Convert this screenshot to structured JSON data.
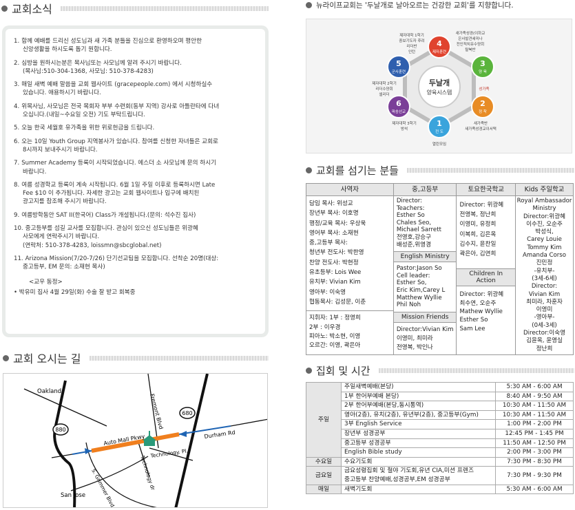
{
  "news": {
    "title": "교회소식",
    "items": [
      {
        "num": "1.",
        "lines": [
          "함께 예배를 드리신 성도님과 새 가족 분들을 진심으로 환영하오며 평안한",
          "신앙생활을 하시도록 돕기 원합니다."
        ]
      },
      {
        "num": "2.",
        "lines": [
          "심방을 원하시는분은 목사님또는 사모님께 알려 주시기 바랍니다.",
          "(목사님:510-304-1368, 사모님: 510-378-4283)"
        ]
      },
      {
        "num": "3.",
        "lines": [
          "매일 새벽 예배 말씀을 교회 웹사이트 (gracepeople.com) 에서 시청하실수",
          "있습니다. 애용하시기 바랍니다."
        ]
      },
      {
        "num": "4.",
        "lines": [
          "위목사님, 사모님은 전국 목회자 부부 수련회(동부 지역) 강사로 아틀란타에 다녀",
          "오십니다.(내일~수요일 오전) 기도 부탁드립니다."
        ]
      },
      {
        "num": "5.",
        "lines": [
          "오늘 한국 세월호 유가족을 위한 위로헌금을 드립니다."
        ]
      },
      {
        "num": "6.",
        "lines": [
          "오는 10일 Youth Group 지역봉사가 있습니다. 참여를 신청한 자녀들은 교회로",
          "8시까지 보내주시기 바랍니다."
        ]
      },
      {
        "num": "7.",
        "lines": [
          "Summer Academy 등록이 시작되었습니다. 에스더 소 사모님께 문의 하시기",
          "바랍니다."
        ]
      },
      {
        "num": "8.",
        "lines": [
          "여름 성경학교 등록이 계속 시작됩니다. 6월 1일 주일 이후로 등록하시면 Late",
          "Fee $10 이 추가됩니다. 자세한 광고는 교회 웹사이트나 입구에 배치된",
          "광고지를 참조해 주시기 바랍니다."
        ]
      },
      {
        "num": "9.",
        "lines": [
          "여름방학동안 SAT II(한국어) Class가 개설됩니다.(문의: 석수진 집사)"
        ]
      },
      {
        "num": "10.",
        "lines": [
          "중고등부를 섬길 교사를 모집합니다. 관심이 있으신 성도님들은 위광혜",
          "사모에게 연락주시기 바랍니다.",
          "(연락처: 510-378-4283, loissmn@sbcglobal.net)"
        ]
      },
      {
        "num": "11.",
        "lines": [
          "Arizona Mission(7/20-7/26) 단기선교팀을 모집합니다. 선착순 20명(대상:",
          "중고등부, EM 문의: 소재현 목사)"
        ]
      }
    ],
    "notice_head": "<교우 동정>",
    "notice": "• 박유미 집사 4월 29일(화) 수술 잘 받고 회복중"
  },
  "directions": {
    "title": "교회 오시는 길",
    "labels": {
      "oakland": "Oakland",
      "san_jose": "San Jose",
      "fremont": "Fremont Blvd",
      "auto_mall": "Auto Mall Pkwy",
      "durham": "Durham Rd",
      "technology_dr": "Technology dr",
      "technology_pl": "Technology. Pl.",
      "grimmer": "S. Grimmer Blvd.",
      "hwy880": "880",
      "hwy680": "680"
    }
  },
  "vision": {
    "title": "뉴라이프교회는 '두날개로 날아오르는 건강한 교회'를 지향합니다.",
    "center1": "두날개",
    "center2": "양육시스템",
    "steps": [
      {
        "n": "1",
        "label": "전 도",
        "color": "#3aa4dc"
      },
      {
        "n": "2",
        "label": "정 착",
        "color": "#e88c25"
      },
      {
        "n": "3",
        "label": "양 육",
        "color": "#5ab43c"
      },
      {
        "n": "4",
        "label": "제자훈련",
        "color": "#e0432e"
      },
      {
        "n": "5",
        "label": "군사훈련",
        "color": "#2f5fae"
      },
      {
        "n": "6",
        "label": "파송선교",
        "color": "#7b3f98"
      }
    ],
    "notes": {
      "top_left": [
        "제자대학 1학기",
        "중보기도자 후려",
        "리더반",
        "인턴"
      ],
      "top_right": [
        "새가족성경(이하교",
        "은사발견세미나",
        "전인적치유수양회",
        "탈북반"
      ],
      "left": [
        "제자대학 2학기",
        "리더수양회",
        "셀리더"
      ],
      "right": "성가족",
      "bottom_left": [
        "제자대학 3학기",
        "방석"
      ],
      "bottom": "열린모임",
      "bottom_right": [
        "새가족반",
        "새가족성경교이서택"
      ]
    }
  },
  "staff": {
    "title": "교회를 섬기는 분들",
    "headers": [
      "사역자",
      "중,고등부",
      "토요한국학교",
      "Kids 주일학교"
    ],
    "col1": [
      "담임 목사: 위성교",
      "장년부 목사: 이호명",
      "행정/교육 목사: 우상욱",
      "영어부 목사: 소재현",
      "중,고등부 목사:",
      "청년부 전도사: 박한영",
      "찬양 전도사: 박현정",
      "유초등부: Lois Wee",
      "유치부: Vivian Kim",
      "영아부: 이숙영",
      "협동목사: 김성문, 이춘"
    ],
    "col1b": [
      "지휘자: 1부 : 정영희",
      "2부 : 이우경",
      "피아노: 박소현, 이영",
      "오르간: 이영, 곽은아"
    ],
    "col2_top": [
      "Director:",
      "Teachers:",
      "Esther So",
      "Chales Seo,",
      "Michael Sarrett",
      "전영호,강승구",
      "배성준,위영경"
    ],
    "col2_english_head": "English Ministry",
    "col2_english": [
      "Pastor:Jason So",
      "Cell leader:",
      "Esther So,",
      "Eric Kim,Carey L",
      "Matthew Wyllie",
      "Phil Noh"
    ],
    "col2_mission_head": "Mission Friends",
    "col2_mission": [
      "Director:Vivian Kim",
      "이영미, 최미라",
      "전영복, 박인나"
    ],
    "col3_top": [
      "Director: 위광혜",
      "전영복, 정난희",
      "이영미, 유정희",
      "이복희, 김은옥",
      "김수지, 윤찬일",
      "곽은아, 김연희"
    ],
    "col3_children_head": "Children In Action",
    "col3_children": [
      "Director: 위광혜",
      "최수연, 오순주",
      "Mathew Wyllie",
      "Esther So",
      "Sam Lee"
    ],
    "col4": [
      "Royal Ambassador",
      "Ministry",
      "Director:위광혜",
      "이수진, 오순주",
      "박성식,",
      "Carey Louie",
      "Tommy Kim",
      "Amanda Corso",
      "진민정",
      "-유치부-",
      "(3세-6세)",
      "Director:",
      "Vivian Kim",
      "최미라, 차훈자",
      "이영미",
      "-영아부-",
      "(0세-3세)",
      "Director:이숙영",
      "김윤옥, 윤영실",
      "정난희"
    ]
  },
  "schedule": {
    "title": "집회 및 시간",
    "groups": [
      {
        "day": "주일",
        "rows": [
          {
            "name": "주일새벽예배(본당)",
            "time": "5:30 AM - 6:00 AM"
          },
          {
            "name": "1부 한어부예배 본당)",
            "time": "8:40 AM - 9:50 AM"
          },
          {
            "name": "2부 한어부예배(본당,동시통역)",
            "time": "10:30 AM - 11:50 AM"
          },
          {
            "name": "영아(2층), 유치(2층), 유년부(2층), 중고등부(Gym)",
            "time": "10:30 AM - 11:50 AM"
          },
          {
            "name": "3부 English Service",
            "time": "1:00 PM - 2:00 PM"
          },
          {
            "name": "장년부 성경공부",
            "time": "12:45 PM - 1:45 PM"
          },
          {
            "name": "중고등부 성경공부",
            "time": "11:50 AM - 12:50 PM"
          },
          {
            "name": "English Bible study",
            "time": "2:00 PM -  3:00 PM"
          }
        ]
      },
      {
        "day": "수요일",
        "rows": [
          {
            "name": "수요기도회",
            "time": "7:30 PM - 8:30 PM"
          }
        ]
      },
      {
        "day": "금요일",
        "rows": [
          {
            "name": "금요성령집회 및 철야 기도회,유년 CIA,미션 프렌즈",
            "name2": "중고등부 찬양예배,성경공부,EM 성경공부",
            "time": "7:30 PM - 9:30 PM"
          }
        ]
      },
      {
        "day": "매일",
        "rows": [
          {
            "name": "새벽기도회",
            "time": "5:30 AM - 6:00 AM"
          }
        ]
      }
    ]
  }
}
